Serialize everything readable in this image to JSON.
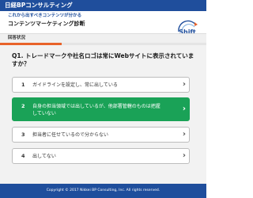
{
  "topbar": {
    "brand": "日経BPコンサルティング"
  },
  "header": {
    "subtitle": "これから出すべきコンテンツが分かる",
    "title": "コンテンツマーケティング診断",
    "logo_text": "Shift"
  },
  "status": {
    "label": "回答状況",
    "progress": 0.3
  },
  "question": "Q1. トレードマークや社名ロゴは常にWebサイトに表示されていますか？",
  "options": [
    {
      "number": "1",
      "line1": "ガイドラインを設定し、常に出している",
      "line2": "",
      "selected": false
    },
    {
      "number": "2",
      "line1": "自身の担当領域では出しているが、他部署管轄のものは把握",
      "line2": "していない",
      "selected": true
    },
    {
      "number": "3",
      "line1": "担当者に任せているので分からない",
      "line2": "",
      "selected": false
    },
    {
      "number": "4",
      "line1": "出してない",
      "line2": "",
      "selected": false
    }
  ],
  "arrow_glyph": "›",
  "footer": {
    "copyright": "Copyright © 2017 Nikkei BP Consulting, Inc. All rights reserved."
  },
  "colors": {
    "brand_blue": "#1f4e9c",
    "accent_orange": "#e8632a",
    "selected_green": "#1aa257",
    "background": "#f2f2f2"
  }
}
